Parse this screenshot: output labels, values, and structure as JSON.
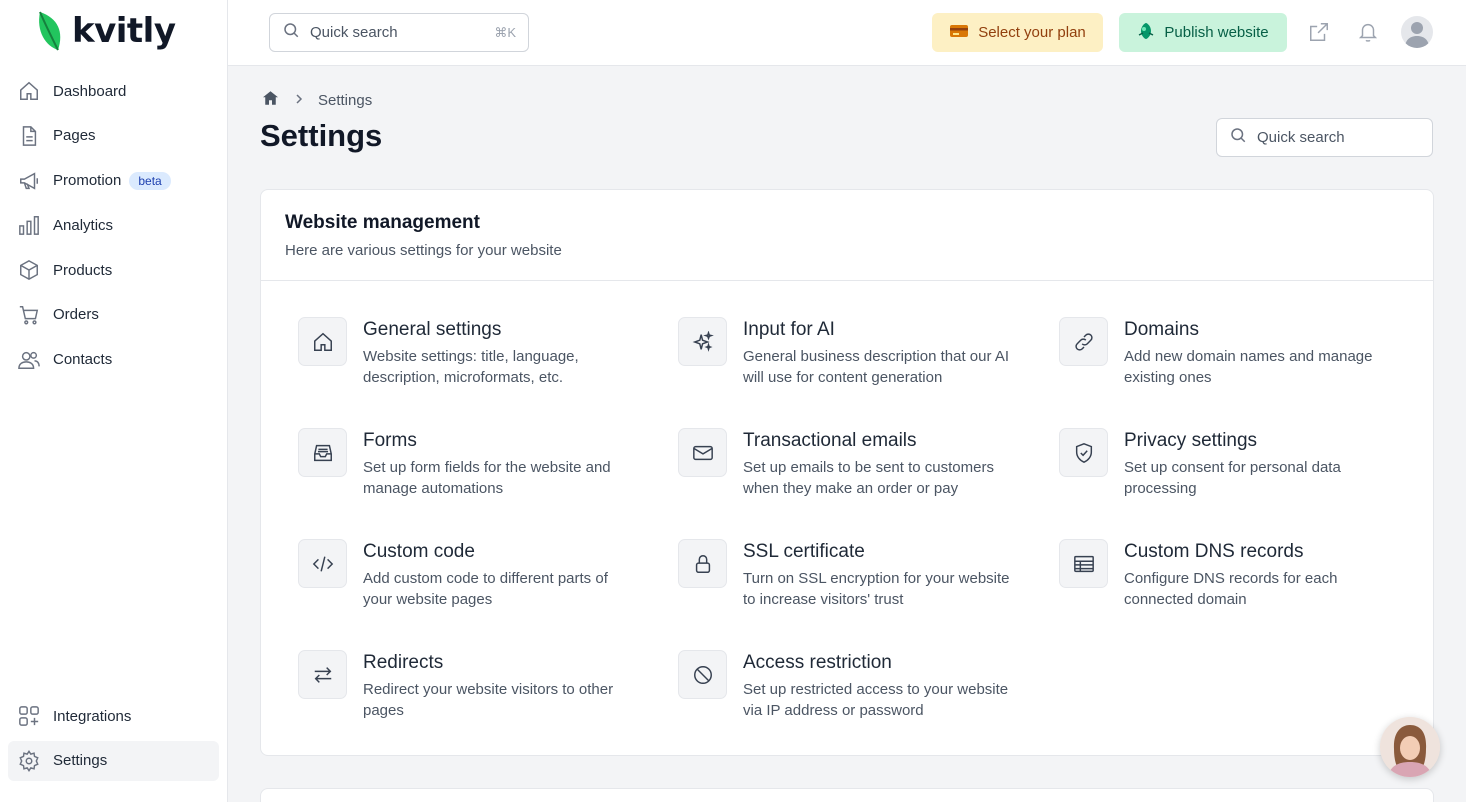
{
  "app": {
    "logo": "kvitly"
  },
  "sidebar": {
    "items": [
      {
        "label": "Dashboard",
        "icon": "home-icon"
      },
      {
        "label": "Pages",
        "icon": "file-icon"
      },
      {
        "label": "Promotion",
        "icon": "megaphone-icon",
        "badge": "beta"
      },
      {
        "label": "Analytics",
        "icon": "bar-chart-icon"
      },
      {
        "label": "Products",
        "icon": "box-icon"
      },
      {
        "label": "Orders",
        "icon": "cart-icon"
      },
      {
        "label": "Contacts",
        "icon": "users-icon"
      }
    ],
    "bottom": [
      {
        "label": "Integrations",
        "icon": "grid-plus-icon"
      },
      {
        "label": "Settings",
        "icon": "gear-icon",
        "active": true
      }
    ]
  },
  "topbar": {
    "search_placeholder": "Quick search",
    "search_shortcut": "⌘K",
    "plan_label": "Select your plan",
    "publish_label": "Publish website"
  },
  "breadcrumb": {
    "current": "Settings"
  },
  "page": {
    "title": "Settings",
    "search_placeholder": "Quick search"
  },
  "card": {
    "title": "Website management",
    "subtitle": "Here are various settings for your website",
    "items": [
      {
        "title": "General settings",
        "desc": "Website settings: title, language, description, microformats, etc.",
        "icon": "home-icon"
      },
      {
        "title": "Input for AI",
        "desc": "General business description that our AI will use for content generation",
        "icon": "sparkles-icon"
      },
      {
        "title": "Domains",
        "desc": "Add new domain names and manage existing ones",
        "icon": "link-icon"
      },
      {
        "title": "Forms",
        "desc": "Set up form fields for the website and manage automations",
        "icon": "inbox-icon"
      },
      {
        "title": "Transactional emails",
        "desc": "Set up emails to be sent to customers when they make an order or pay",
        "icon": "mail-icon"
      },
      {
        "title": "Privacy settings",
        "desc": "Set up consent for personal data processing",
        "icon": "shield-check-icon"
      },
      {
        "title": "Custom code",
        "desc": "Add custom code to different parts of your website pages",
        "icon": "code-icon"
      },
      {
        "title": "SSL certificate",
        "desc": "Turn on SSL encryption for your website to increase visitors' trust",
        "icon": "lock-icon"
      },
      {
        "title": "Custom DNS records",
        "desc": "Configure DNS records for each connected domain",
        "icon": "table-icon"
      },
      {
        "title": "Redirects",
        "desc": "Redirect your website visitors to other pages",
        "icon": "arrows-exchange-icon"
      },
      {
        "title": "Access restriction",
        "desc": "Set up restricted access to your website via IP address or password",
        "icon": "ban-icon"
      }
    ]
  }
}
